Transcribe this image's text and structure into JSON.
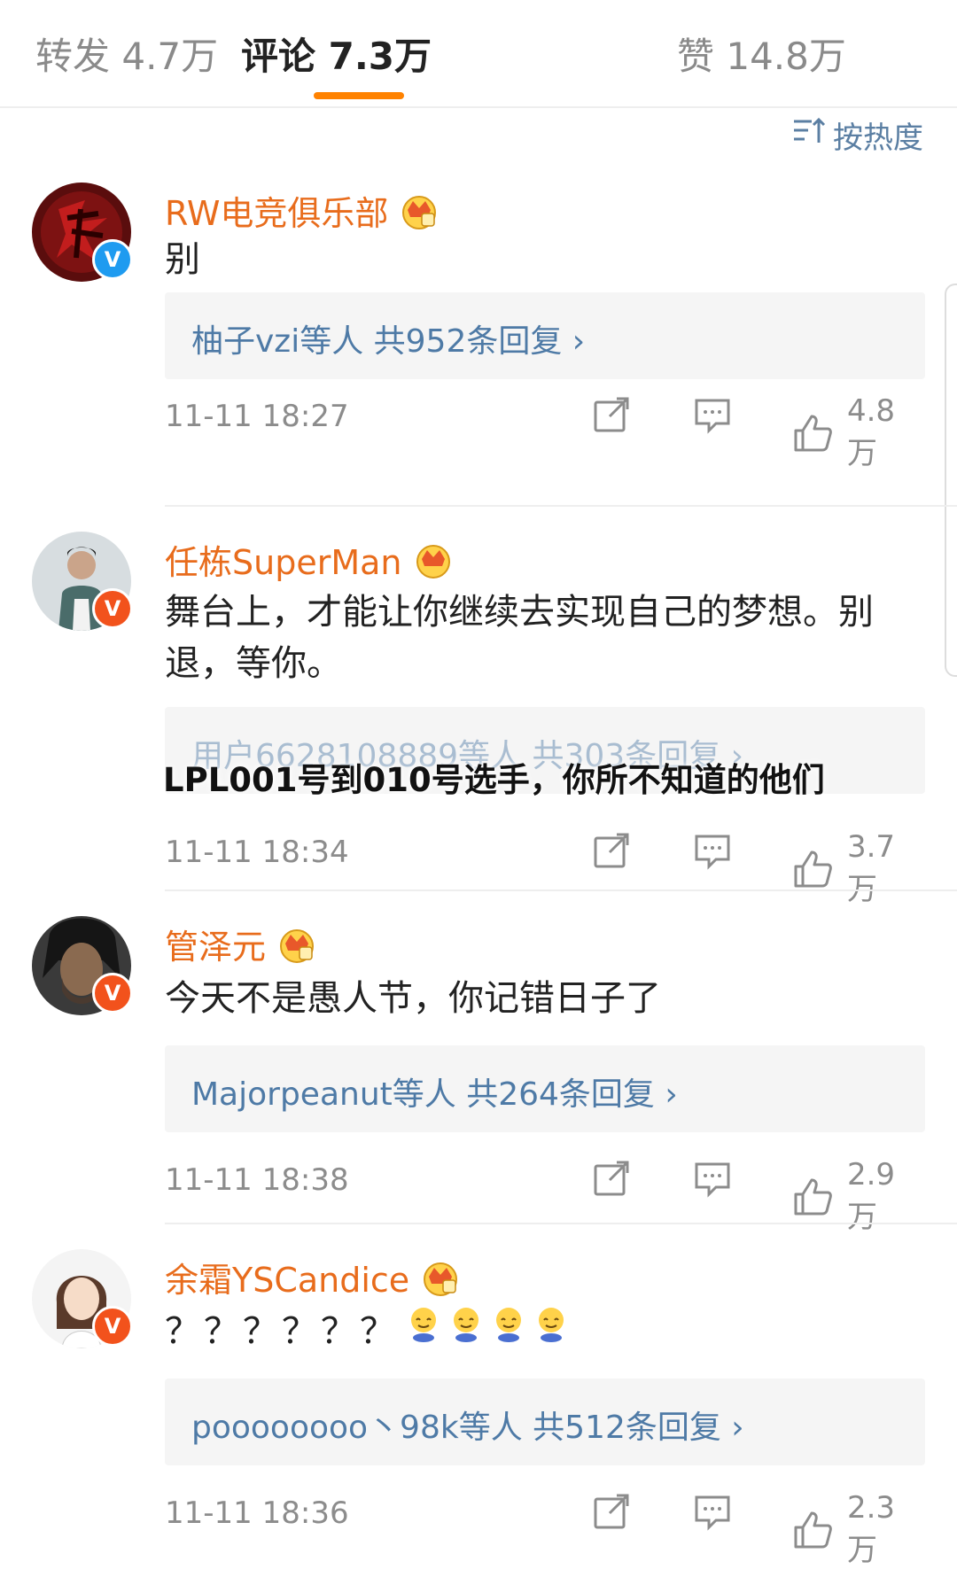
{
  "tabs": [
    {
      "label": "转发 4.7万"
    },
    {
      "label": "评论 7.3万"
    },
    {
      "label": "赞 14.8万"
    }
  ],
  "sort": {
    "label": "按热度",
    "icon": "sort-icon"
  },
  "overlay_title": "LPL001号到010号选手，你所不知道的他们",
  "colors": {
    "accent": "#ff8200",
    "username": "#e86c1c",
    "link": "#4e7aa6"
  },
  "comments": [
    {
      "username": "RW电竞俱乐部",
      "badge": "V",
      "badge_color": "blue",
      "content": "别",
      "reply_summary": "柚子vzi等人  共952条回复 ›",
      "time": "11-11 18:27",
      "likes": "4.8万"
    },
    {
      "username": "任栋SuperMan",
      "badge": "V",
      "badge_color": "orange",
      "content": "舞台上，才能让你继续去实现自己的梦想。别退，等你。",
      "reply_summary": "用户6628108889等人  共303条回复 ›",
      "time": "11-11 18:34",
      "likes": "3.7万"
    },
    {
      "username": "管泽元",
      "badge": "V",
      "badge_color": "orange",
      "content": "今天不是愚人节，你记错日子了",
      "reply_summary": "Majorpeanut等人  共264条回复 ›",
      "time": "11-11 18:38",
      "likes": "2.9万"
    },
    {
      "username": "余霜YSCandice",
      "badge": "V",
      "badge_color": "orange",
      "content": "？？？？？？",
      "emoji_count": 4,
      "reply_summary": "poooooooo丶98k等人  共512条回复 ›",
      "time": "11-11 18:36",
      "likes": "2.3万"
    }
  ]
}
